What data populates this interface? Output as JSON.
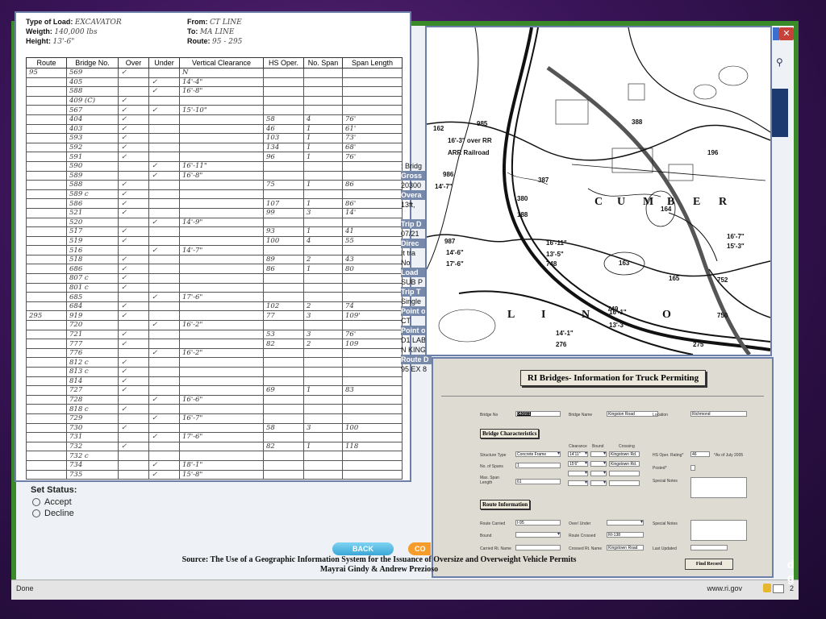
{
  "browser": {
    "status_text": "Done",
    "url_text": "www.ri.gov",
    "badge_count": "2",
    "close_glyph": "✕",
    "search_glyph": "⚲"
  },
  "form": {
    "type_label": "Type of Load:",
    "type_value": "EXCAVATOR",
    "weight_label": "Weigth:",
    "weight_value": "140,000 lbs",
    "height_label": "Height:",
    "height_value": "13'-6\"",
    "from_label": "From:",
    "from_value": "CT LINE",
    "to_label": "To:",
    "to_value": "MA LINE",
    "route_label": "Route:",
    "route_value": "95 - 295",
    "columns": [
      "Route",
      "Bridge No.",
      "Over",
      "Under",
      "Vertical Clearance",
      "HS Oper.",
      "No. Span",
      "Span Length"
    ],
    "rows": [
      [
        "95",
        "569",
        "✓",
        "",
        "N",
        "",
        "",
        ""
      ],
      [
        "",
        "405",
        "",
        "✓",
        "14'-4\"",
        "",
        "",
        ""
      ],
      [
        "",
        "588",
        "",
        "✓",
        "16'-8\"",
        "",
        "",
        ""
      ],
      [
        "",
        "409 (C)",
        "✓",
        "",
        "",
        "",
        "",
        ""
      ],
      [
        "",
        "567",
        "✓",
        "✓",
        "15'-10\"",
        "",
        "",
        ""
      ],
      [
        "",
        "404",
        "✓",
        "",
        "",
        "58",
        "4",
        "76'"
      ],
      [
        "",
        "403",
        "✓",
        "",
        "",
        "46",
        "1",
        "61'"
      ],
      [
        "",
        "593",
        "✓",
        "",
        "",
        "103",
        "1",
        "73'"
      ],
      [
        "",
        "592",
        "✓",
        "",
        "",
        "134",
        "1",
        "68'"
      ],
      [
        "",
        "591",
        "✓",
        "",
        "",
        "96",
        "1",
        "76'"
      ],
      [
        "",
        "590",
        "",
        "✓",
        "16'-11\"",
        "",
        "",
        ""
      ],
      [
        "",
        "589",
        "",
        "✓",
        "16'-8\"",
        "",
        "",
        ""
      ],
      [
        "",
        "588",
        "✓",
        "",
        "",
        "75",
        "1",
        "86"
      ],
      [
        "",
        "589 c",
        "✓",
        "",
        "",
        "",
        "",
        ""
      ],
      [
        "",
        "586",
        "✓",
        "",
        "",
        "107",
        "1",
        "86'"
      ],
      [
        "",
        "521",
        "✓",
        "",
        "",
        "99",
        "3",
        "14'"
      ],
      [
        "",
        "520",
        "",
        "✓",
        "14'-9\"",
        "",
        "",
        ""
      ],
      [
        "",
        "517",
        "✓",
        "",
        "",
        "93",
        "1",
        "41"
      ],
      [
        "",
        "519",
        "✓",
        "",
        "",
        "100",
        "4",
        "55"
      ],
      [
        "",
        "516",
        "",
        "✓",
        "14'-7\"",
        "",
        "",
        ""
      ],
      [
        "",
        "518",
        "✓",
        "",
        "",
        "89",
        "2",
        "43"
      ],
      [
        "",
        "686",
        "✓",
        "",
        "",
        "86",
        "1",
        "80"
      ],
      [
        "",
        "807 c",
        "✓",
        "",
        "",
        "",
        "",
        ""
      ],
      [
        "",
        "801 c",
        "✓",
        "",
        "",
        "",
        "",
        ""
      ],
      [
        "",
        "685",
        "",
        "✓",
        "17'-6\"",
        "",
        "",
        ""
      ],
      [
        "",
        "684",
        "✓",
        "",
        "",
        "102",
        "2",
        "74"
      ],
      [
        "295",
        "919",
        "✓",
        "",
        "",
        "77",
        "3",
        "109'"
      ],
      [
        "",
        "720",
        "",
        "✓",
        "16'-2\"",
        "",
        "",
        ""
      ],
      [
        "",
        "721",
        "✓",
        "",
        "",
        "53",
        "3",
        "76'"
      ],
      [
        "",
        "777",
        "✓",
        "",
        "",
        "82",
        "2",
        "109"
      ],
      [
        "",
        "776",
        "",
        "✓",
        "16'-2\"",
        "",
        "",
        ""
      ],
      [
        "",
        "812 c",
        "✓",
        "",
        "",
        "",
        "",
        ""
      ],
      [
        "",
        "813 c",
        "✓",
        "",
        "",
        "",
        "",
        ""
      ],
      [
        "",
        "814",
        "✓",
        "",
        "",
        "",
        "",
        ""
      ],
      [
        "",
        "727",
        "✓",
        "",
        "",
        "69",
        "1",
        "83"
      ],
      [
        "",
        "728",
        "",
        "✓",
        "16'-6\"",
        "",
        "",
        ""
      ],
      [
        "",
        "818 c",
        "✓",
        "",
        "",
        "",
        "",
        ""
      ],
      [
        "",
        "729",
        "",
        "✓",
        "16'-7\"",
        "",
        "",
        ""
      ],
      [
        "",
        "730",
        "✓",
        "",
        "",
        "58",
        "3",
        "100"
      ],
      [
        "",
        "731",
        "",
        "✓",
        "17'-6\"",
        "",
        "",
        ""
      ],
      [
        "",
        "732",
        "✓",
        "",
        "",
        "82",
        "1",
        "118"
      ],
      [
        "",
        "732 c",
        "",
        "",
        "",
        "",
        "",
        ""
      ],
      [
        "",
        "734",
        "",
        "✓",
        "18'-1\"",
        "",
        "",
        ""
      ],
      [
        "",
        "735",
        "",
        "✓",
        "15'-8\"",
        "",
        "",
        ""
      ]
    ]
  },
  "status_section": {
    "title": "Set Status:",
    "accept": "Accept",
    "decline": "Decline"
  },
  "buttons": {
    "back": "BACK",
    "continue_partial": "CO"
  },
  "source": {
    "line1": "Source: The Use of a Geographic Information System for the Issuance of Oversize and Overweight Vehicle Permits",
    "line2": "Mayrai Gindy & Andrew Prezioso"
  },
  "strip": [
    {
      "t": ": Bridg",
      "lab": false
    },
    {
      "t": "Gross",
      "lab": true
    },
    {
      "t": "20300",
      "lab": false
    },
    {
      "t": "Overa",
      "lab": true
    },
    {
      "t": "13ft, ",
      "lab": false
    },
    {
      "t": "",
      "lab": false
    },
    {
      "t": "Trip D",
      "lab": true
    },
    {
      "t": "07/21",
      "lab": false
    },
    {
      "t": "Direc",
      "lab": true
    },
    {
      "t": "It tra",
      "lab": false
    },
    {
      "t": "No",
      "lab": false
    },
    {
      "t": "Load",
      "lab": true
    },
    {
      "t": "SUB P",
      "lab": false
    },
    {
      "t": "Trip T",
      "lab": true
    },
    {
      "t": "Single",
      "lab": false
    },
    {
      "t": "Point o",
      "lab": true
    },
    {
      "t": "CT",
      "lab": false
    },
    {
      "t": "Point o",
      "lab": true
    },
    {
      "t": "D1 LAB",
      "lab": false
    },
    {
      "t": "N KINGS",
      "lab": false
    },
    {
      "t": "Route D",
      "lab": true
    },
    {
      "t": "95 EX 8",
      "lab": false
    }
  ],
  "map": {
    "labels": [
      "985",
      "162",
      "388",
      "196",
      "986",
      "14'-7\"",
      "380",
      "188",
      "387",
      "C",
      "U",
      "M",
      "B",
      "E",
      "R",
      "164",
      "987",
      "14'-6\"",
      "17'-6\"",
      "16'-11\"",
      "13'-5\"",
      "748",
      "163",
      "165",
      "752",
      "L",
      "I",
      "N",
      "O",
      "749",
      "750",
      "276",
      "275",
      "16'-7\"",
      "15'-3\"",
      "16'-1\"",
      "14'-1\"",
      "13'-3\"",
      "16'-3\" over RR",
      "ARR Railroad"
    ]
  },
  "ri_form": {
    "title": "RI Bridges- Information for Truck Permiting",
    "bridge_no_label": "Bridge No",
    "bridge_no": "040601",
    "bridge_name_label": "Bridge Name",
    "bridge_name": "Kingston Road",
    "location_label": "Location",
    "location": "Richmond",
    "section1": "Bridge Characteristics",
    "structure_type_label": "Structure Type",
    "structure_type": "Concrete Frame",
    "clearance_hdr": "Clearance",
    "bound_hdr": "Bound",
    "crossing_hdr": "Crossing",
    "clearance1": "14'11\"",
    "crossing1": "Kingstown Rd.",
    "hs_label": "HS Oper. Rating*",
    "hs_value": "46",
    "hs_note": "*As of July 2005",
    "spans_label": "No. of Spans",
    "spans_value": "1",
    "clearance2": "15'6\"",
    "crossing2": "Kingstown Rd.",
    "posted_label": "Posted*",
    "max_span_label": "Max. Span Length",
    "max_span_value": "61",
    "special_notes_label": "Special Notes",
    "section2": "Route Information",
    "route_carried_label": "Route Carried",
    "route_carried": "I-95",
    "over_under_label": "Over/ Under",
    "special_notes2_label": "Special Notes",
    "bound_label": "Bound",
    "route_crossed_label": "Route Crossed",
    "route_crossed": "RI-138",
    "carried_name_label": "Carried Rt. Name",
    "crossed_name_label": "Crossed Rt. Name",
    "crossed_name": "Kingstown Road",
    "last_updated_label": "Last Updated",
    "find_button": "Find Record"
  },
  "right_edge": {
    "line1": "d",
    "line2": "g"
  }
}
